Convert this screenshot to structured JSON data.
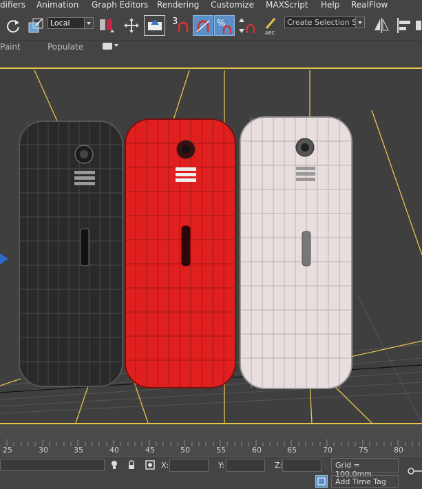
{
  "menu": {
    "items": [
      "difiers",
      "Animation",
      "Graph Editors",
      "Rendering",
      "Customize",
      "MAXScript",
      "Help",
      "RealFlow"
    ]
  },
  "toolbar": {
    "reference_coord": "Local",
    "snap_number": "3",
    "selection_set_placeholder": "Create Selection Se"
  },
  "ribbon": {
    "tabs": [
      "Paint",
      "Populate"
    ]
  },
  "timeline": {
    "ticks": [
      "25",
      "30",
      "35",
      "40",
      "45",
      "50",
      "55",
      "60",
      "65",
      "70",
      "75",
      "80"
    ]
  },
  "status": {
    "x_label": "X:",
    "y_label": "Y:",
    "z_label": "Z:",
    "grid_text": "Grid = 100.0mm",
    "add_time_tag": "Add Time Tag"
  },
  "colors": {
    "viewport_bg": "#3f3f3f",
    "grid_yellow": "#e6c44a",
    "phone_black": "#2a2a2a",
    "phone_red": "#e0201f",
    "phone_white": "#e8dede",
    "active_button": "#5c8fc7"
  },
  "viewport": {
    "objects": [
      "phone-black",
      "phone-red",
      "phone-white"
    ]
  }
}
